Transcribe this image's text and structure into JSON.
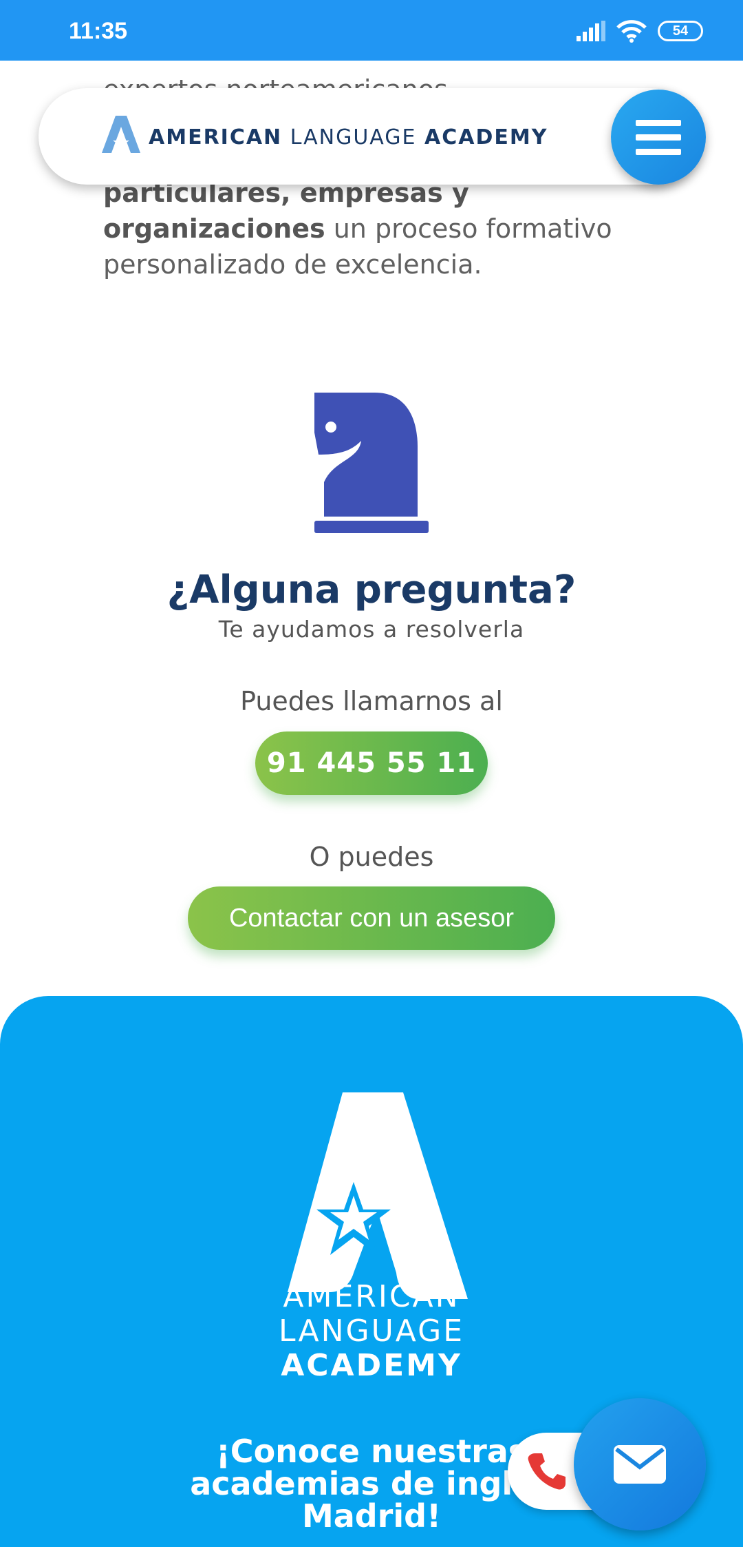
{
  "status_bar": {
    "time": "11:35",
    "battery": "54"
  },
  "intro": {
    "top_clipped": "expertos norteamericanos",
    "bold_line": "particulares, empresas y",
    "bold_word": "organizaciones",
    "rest_line2": " un proceso formativo",
    "line3": "personalizado de excelencia."
  },
  "header": {
    "brand_part1": "AMERICAN",
    "brand_part2": " LANGUAGE ",
    "brand_part3": "ACADEMY"
  },
  "question": {
    "title": "¿Alguna pregunta?",
    "subtitle": "Te ayudamos a resolverla",
    "call_label": "Puedes llamarnos al",
    "phone": "91 445 55 11",
    "or_label": "O puedes",
    "contact_label": "Contactar con un asesor"
  },
  "footer": {
    "brand_line1": "AMERICAN",
    "brand_line2": "LANGUAGE",
    "brand_line3": "ACADEMY",
    "cta_line1": "¡Conoce nuestras",
    "cta_line2": "academias de inglés",
    "cta_line3": "Madrid!"
  },
  "colors": {
    "status_bar": "#2196f3",
    "brand_navy": "#1a3a66",
    "accent_blue": "#06a4f0",
    "knight_blue": "#3f51b5",
    "button_green": "#4caf50",
    "phone_red": "#e53935"
  },
  "icons": [
    "signal-icon",
    "wifi-icon",
    "battery-icon",
    "logo-icon",
    "menu-icon",
    "chess-knight-icon",
    "phone-icon",
    "mail-icon"
  ]
}
